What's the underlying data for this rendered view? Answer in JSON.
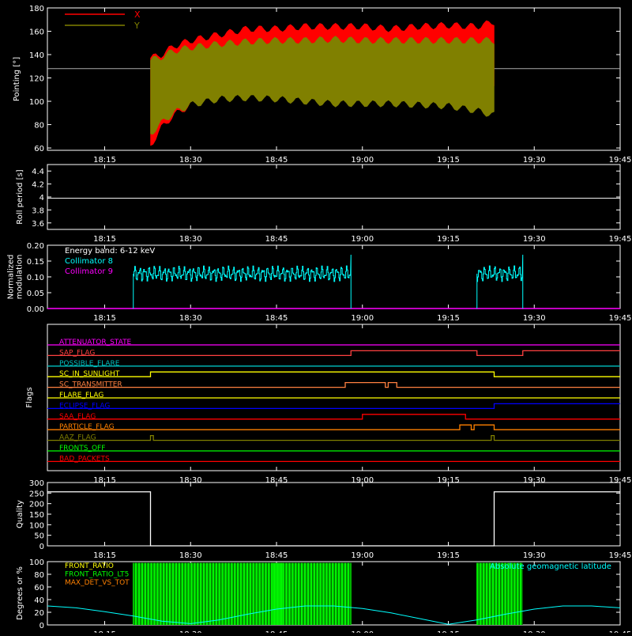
{
  "x_axis": {
    "start": "18:05",
    "end": "19:45",
    "ticks": [
      "18:15",
      "18:30",
      "18:45",
      "19:00",
      "19:15",
      "19:30",
      "19:45"
    ]
  },
  "colors": {
    "axes": "#ffffff",
    "x": "#ff0000",
    "y": "#808000",
    "cyan": "#00ffff",
    "magenta": "#ff00ff",
    "green": "#00ff00",
    "orange": "#ff8000",
    "yellow": "#ffff00",
    "blue": "#0000ff",
    "red": "#ff0000"
  },
  "chart_data": [
    {
      "type": "area",
      "ylabel": "Pointing [°]",
      "ylim": [
        58,
        180
      ],
      "yticks": [
        60,
        80,
        100,
        120,
        140,
        160,
        180
      ],
      "reference_line": 128,
      "legend": [
        {
          "name": "X",
          "color": "#ff0000"
        },
        {
          "name": "Y",
          "color": "#808000"
        }
      ],
      "series": [
        {
          "name": "X",
          "x": [
            "18:23",
            "18:25",
            "18:27",
            "18:30",
            "18:35",
            "18:40",
            "18:45",
            "18:50",
            "18:55",
            "19:00",
            "19:05",
            "19:10",
            "19:15",
            "19:20",
            "19:23"
          ],
          "high": [
            137,
            140,
            147,
            152,
            157,
            162,
            162,
            164,
            164,
            164,
            162,
            164,
            165,
            164,
            168
          ],
          "low": [
            62,
            78,
            88,
            97,
            106,
            110,
            112,
            112,
            112,
            114,
            113,
            113,
            112,
            111,
            110
          ]
        },
        {
          "name": "Y",
          "x": [
            "18:23",
            "18:25",
            "18:27",
            "18:30",
            "18:35",
            "18:40",
            "18:45",
            "18:50",
            "18:55",
            "19:00",
            "19:05",
            "19:10",
            "19:15",
            "19:20",
            "19:23"
          ],
          "high": [
            135,
            138,
            143,
            146,
            149,
            151,
            152,
            152,
            153,
            152,
            152,
            152,
            152,
            152,
            152
          ],
          "low": [
            72,
            82,
            90,
            97,
            102,
            103,
            102,
            100,
            98,
            98,
            98,
            97,
            96,
            92,
            88
          ]
        }
      ]
    },
    {
      "type": "line",
      "ylabel": "Roll period [s]",
      "ylim": [
        3.5,
        4.5
      ],
      "yticks": [
        3.6,
        3.8,
        4.0,
        4.2,
        4.4
      ],
      "series": [
        {
          "name": "",
          "x": [
            "18:05",
            "19:45"
          ],
          "values": [
            3.98,
            3.98
          ]
        }
      ]
    },
    {
      "type": "line",
      "ylabel": "Normalized modulation",
      "ylim": [
        0,
        0.2
      ],
      "yticks": [
        "0.00",
        "0.05",
        "0.10",
        "0.15",
        "0.20"
      ],
      "annotation": "Energy band: 6-12 keV",
      "series": [
        {
          "name": "Collimator 8",
          "color": "#00ffff",
          "segments": [
            [
              "18:20",
              "18:58",
              0.11
            ],
            [
              "19:20",
              "19:28",
              0.11
            ]
          ],
          "peak": 0.17
        },
        {
          "name": "Collimator 9",
          "color": "#ff00ff",
          "values_constant": 0.0
        }
      ]
    },
    {
      "type": "line",
      "ylabel": "Flags",
      "flags": [
        {
          "name": "ATTENUATOR_STATE",
          "color": "#ff00ff",
          "changes": []
        },
        {
          "name": "SAP_FLAG",
          "color": "#ff4040",
          "changes": [
            [
              "18:58",
              1
            ],
            [
              "19:20",
              0
            ],
            [
              "19:28",
              1
            ]
          ]
        },
        {
          "name": "POSSIBLE_FLARE",
          "color": "#00c0c0",
          "changes": []
        },
        {
          "name": "SC_IN_SUNLIGHT",
          "color": "#ffff00",
          "changes": [
            [
              "18:23",
              1
            ],
            [
              "19:23",
              0
            ]
          ]
        },
        {
          "name": "SC_TRANSMITTER",
          "color": "#ff8040",
          "changes": [
            [
              "18:57",
              1
            ],
            [
              "19:04",
              0
            ],
            [
              "19:04.5",
              1
            ],
            [
              "19:06",
              0
            ]
          ]
        },
        {
          "name": "FLARE_FLAG",
          "color": "#ffff00",
          "changes": []
        },
        {
          "name": "ECLIPSE_FLAG",
          "color": "#0000ff",
          "changes": [
            [
              "18:23",
              0
            ],
            [
              "19:23",
              1
            ]
          ]
        },
        {
          "name": "SAA_FLAG",
          "color": "#ff0000",
          "changes": [
            [
              "19:00",
              1
            ],
            [
              "19:18",
              0
            ]
          ]
        },
        {
          "name": "PARTICLE_FLAG",
          "color": "#ff8000",
          "changes": [
            [
              "19:16.5",
              0
            ],
            [
              "19:17",
              1
            ],
            [
              "19:19",
              0
            ],
            [
              "19:19.5",
              1
            ],
            [
              "19:23",
              0
            ]
          ]
        },
        {
          "name": "AAZ_FLAG",
          "color": "#808000",
          "changes": [
            [
              "18:23",
              1
            ],
            [
              "18:23.5",
              0
            ],
            [
              "19:22.5",
              1
            ],
            [
              "19:23",
              0
            ]
          ]
        },
        {
          "name": "FRONTS_OFF",
          "color": "#00ff00",
          "changes": []
        },
        {
          "name": "BAD_PACKETS",
          "color": "#ff0000",
          "changes": []
        }
      ]
    },
    {
      "type": "line",
      "ylabel": "Quality",
      "ylim": [
        0,
        300
      ],
      "yticks": [
        0,
        50,
        100,
        150,
        200,
        250,
        300
      ],
      "series": [
        {
          "name": "",
          "x": [
            "18:05",
            "18:23",
            "18:23",
            "19:23",
            "19:23",
            "19:45"
          ],
          "values": [
            256,
            256,
            0,
            0,
            256,
            256
          ]
        }
      ]
    },
    {
      "type": "line",
      "ylabel": "Degrees or %",
      "ylim": [
        0,
        100
      ],
      "yticks": [
        0,
        20,
        40,
        60,
        80,
        100
      ],
      "legend": [
        {
          "name": "FRONT_RATIO",
          "color": "#ffff00"
        },
        {
          "name": "FRONT_RATIO_LT5",
          "color": "#00ff00"
        },
        {
          "name": "MAX_DET_VS_TOT",
          "color": "#ff8000"
        }
      ],
      "annotation": "Absolute geomagnetic latitude",
      "series": [
        {
          "name": "FRONT_RATIO_LT5",
          "color": "#00ff00",
          "bursts": [
            [
              "18:20",
              "18:58"
            ],
            [
              "19:20",
              "19:28"
            ]
          ],
          "value": 98
        },
        {
          "name": "Absolute geomagnetic latitude",
          "color": "#00ffff",
          "x": [
            "18:05",
            "18:10",
            "18:15",
            "18:20",
            "18:25",
            "18:30",
            "18:35",
            "18:40",
            "18:45",
            "18:50",
            "18:55",
            "19:00",
            "19:05",
            "19:10",
            "19:15",
            "19:20",
            "19:25",
            "19:30",
            "19:35",
            "19:40",
            "19:45"
          ],
          "values": [
            30,
            27,
            21,
            14,
            6,
            2,
            8,
            17,
            25,
            30,
            30,
            26,
            19,
            10,
            1,
            8,
            17,
            25,
            30,
            30,
            27
          ]
        }
      ]
    }
  ]
}
